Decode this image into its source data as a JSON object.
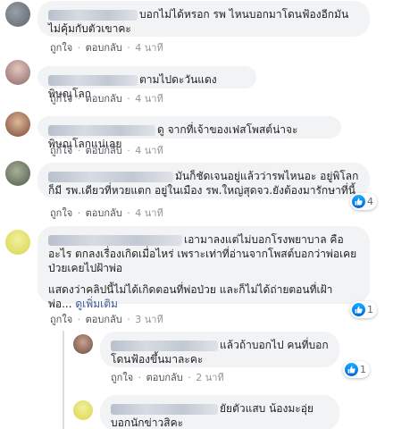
{
  "actions": {
    "like": "ถูกใจ",
    "reply": "ตอบกลับ",
    "sep": "·"
  },
  "comments": [
    {
      "text": "บอกไม่ได้หรอก รพ ไหนบอกมาโดนฟ้องอีกมันไม่คุ้มกับตัวเขาคะ",
      "time": "4 นาที"
    },
    {
      "text": "ตามไปดะวันแดงพิษณุโลก",
      "time": "4 นาที"
    },
    {
      "text": "ดู จากที่เจ้าของเฟสโพสต์น่าจะพิษณุโลกแน่เลย",
      "time": "4 นาที"
    },
    {
      "text": "มันก็ชัดเจนอยู่แล้วว่ารพไหนอะ อยู่พิโลกก็มี รพ.เดียวที่หวยแตก อยู่ในเมือง รพ.ใหญ่สุดจว.ยังต้องมารักษาที่นี้",
      "time": "4 นาที",
      "reactions": "4"
    },
    {
      "text": "เอามาลงแต่ไม่บอกโรงพยาบาล คือ อะไร ตกลงเรื่องเกิดเมื่อไหร่ เพราะเท่าที่อ่านจากโพสต์บอกว่าพ่อเคย ป่วยเคยไปฝ้าพ่อ",
      "text2": "แสดงว่าคลิปนี้ไม่ได้เกิดตอนที่พ่อป่วย และก็ไม่ได้ถ่ายตอนที่เฝ้า พ่อ...",
      "see_more": "ดูเพิ่มเติม",
      "time": "3 นาที",
      "reactions": "1"
    }
  ],
  "replies": [
    {
      "text": "แล้วถ้าบอกไป คนที่บอกโดนฟ้องขึ้นมาละคะ",
      "time": "2 นาที",
      "reactions": "1"
    },
    {
      "text": "ยัยตัวแสบ น้องมะอุ่ย บอกนักข่าวสิคะ"
    }
  ]
}
